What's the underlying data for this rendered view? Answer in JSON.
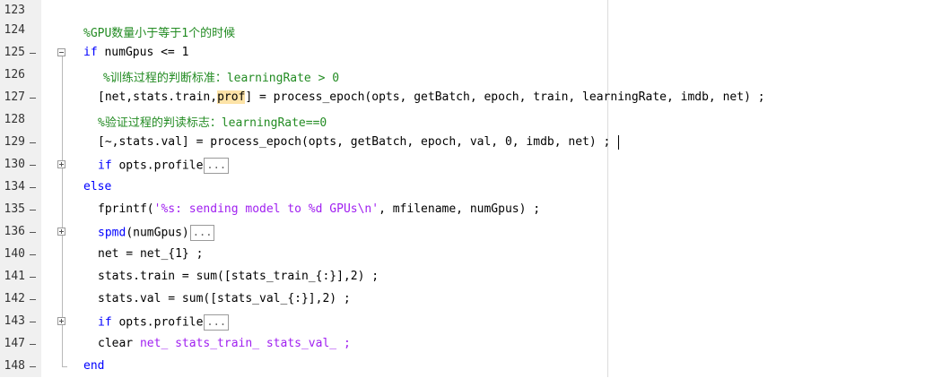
{
  "lines": [
    {
      "num": "123",
      "code": ""
    },
    {
      "num": "124",
      "comment": "%GPU数量小于等于1个的时候"
    },
    {
      "num": "125",
      "kw": "if",
      "rest": " numGpus <= 1"
    },
    {
      "num": "126",
      "comment": "%训练过程的判断标准：learningRate > 0"
    },
    {
      "num": "127",
      "pre": "[net,stats.train,",
      "hl": "prof",
      "post": "] = process_epoch(opts, getBatch, epoch, train, learningRate, imdb, net) ;"
    },
    {
      "num": "128",
      "comment": "%验证过程的判读标志：learningRate==0"
    },
    {
      "num": "129",
      "code": "[~,stats.val] = process_epoch(opts, getBatch, epoch, val, 0, imdb, net) ;"
    },
    {
      "num": "130",
      "kw": "if",
      "rest": " opts.profile",
      "ellipsis": "..."
    },
    {
      "num": "134",
      "kw": "else"
    },
    {
      "num": "135",
      "pre": "fprintf(",
      "str": "'%s: sending model to %d GPUs\\n'",
      "post": ", mfilename, numGpus) ;"
    },
    {
      "num": "136",
      "kw": "spmd",
      "rest": "(numGpus)",
      "ellipsis": "..."
    },
    {
      "num": "140",
      "code": "net = net_{1} ;"
    },
    {
      "num": "141",
      "code": "stats.train = sum([stats_train_{:}],2) ;"
    },
    {
      "num": "142",
      "code": "stats.val = sum([stats_val_{:}],2) ;"
    },
    {
      "num": "143",
      "kw": "if",
      "rest": " opts.profile",
      "ellipsis": "..."
    },
    {
      "num": "147",
      "pre": "clear ",
      "str": "net_ stats_train_ stats_val_ ;"
    },
    {
      "num": "148",
      "kw": "end"
    }
  ],
  "colors": {
    "keyword": "#0000ff",
    "comment": "#228b22",
    "string": "#a020f0",
    "highlight": "#fde3a7"
  }
}
